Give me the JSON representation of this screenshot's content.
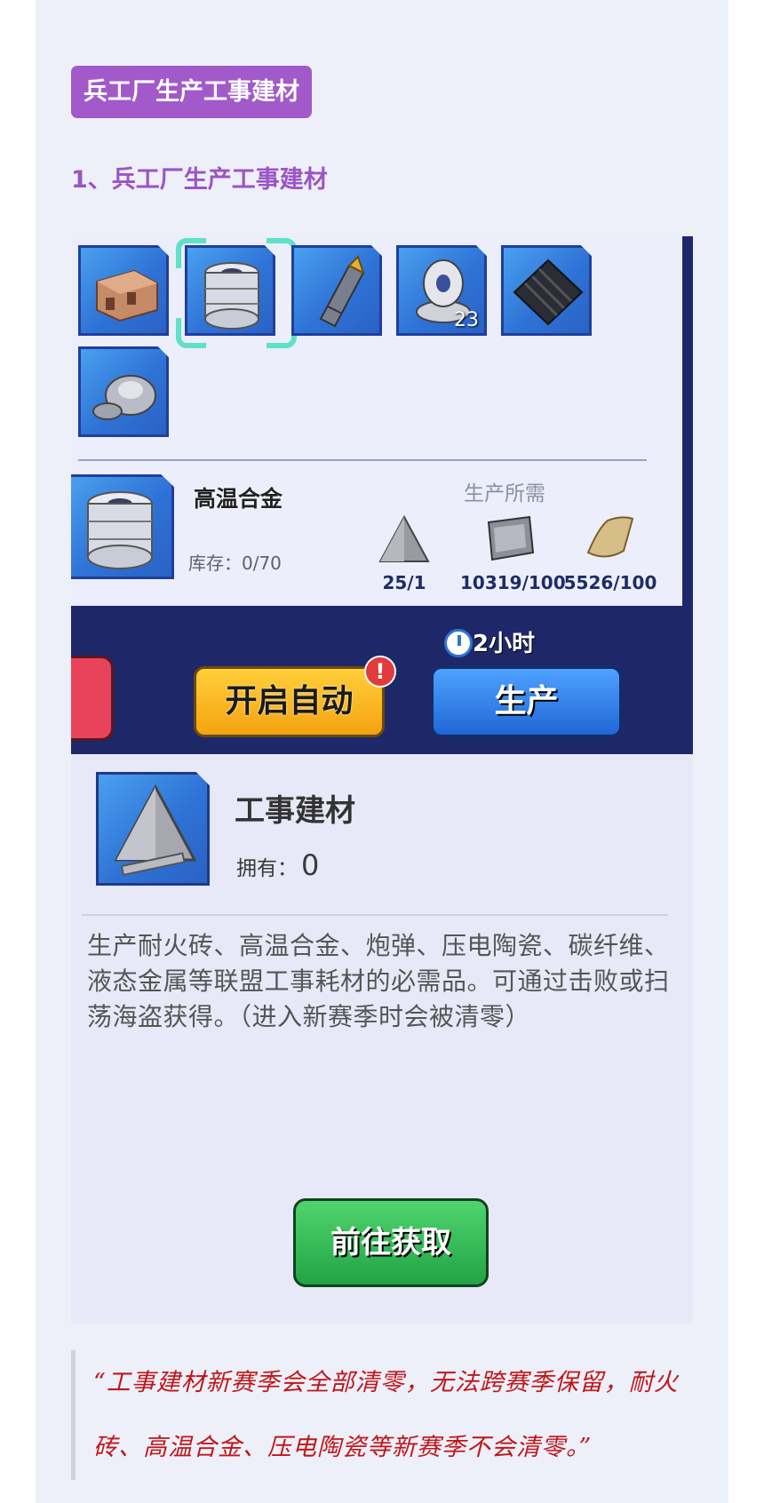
{
  "article": {
    "section_tag": "兵工厂生产工事建材",
    "subheading": "1、兵工厂生产工事建材",
    "quote": "“工事建材新赛季会全部清零，无法跨赛季保留，耐火砖、高温合金、压电陶瓷等新赛季不会清零。”"
  },
  "game": {
    "inventory": [
      {
        "icon": "refractory-brick-icon"
      },
      {
        "icon": "alloy-cylinder-icon",
        "selected": true
      },
      {
        "icon": "shell-icon"
      },
      {
        "icon": "ceramic-disc-icon",
        "count": "23"
      },
      {
        "icon": "carbon-fiber-icon"
      },
      {
        "icon": "liquid-metal-icon"
      }
    ],
    "selected_item": {
      "name": "高温合金",
      "stock": "库存：0/70",
      "requirements_label": "生产所需",
      "requirements": [
        {
          "icon": "fortification-material-icon",
          "value": "25/1"
        },
        {
          "icon": "steel-plate-icon",
          "value": "10319/100"
        },
        {
          "icon": "leather-icon",
          "value": "5526/100"
        }
      ]
    },
    "timer": "2小时",
    "auto_button": "开启自动",
    "auto_badge": "!",
    "produce_button": "生产",
    "detail": {
      "title": "工事建材",
      "owned_label": "拥有：",
      "owned_value": "0",
      "description": "生产耐火砖、高温合金、炮弹、压电陶瓷、碳纤维、液态金属等联盟工事耗材的必需品。可通过击败或扫荡海盗获得。（进入新赛季时会被清零）",
      "goto_button": "前往获取"
    }
  },
  "colors": {
    "tag_bg": "#a259c9",
    "quote_text": "#c0161b",
    "panel_navy": "#1e2868",
    "produce_blue": "#2f73d6",
    "auto_yellow": "#f4a310",
    "goto_green": "#22a446"
  }
}
